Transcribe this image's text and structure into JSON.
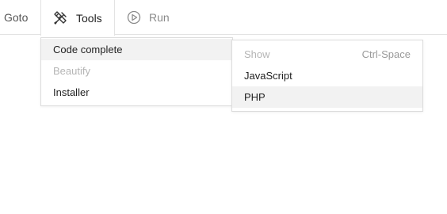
{
  "toolbar": {
    "goto_label": "Goto",
    "tools_label": "Tools",
    "run_label": "Run",
    "tools_icon": "tools-icon",
    "run_icon": "play-circle-icon"
  },
  "tools_menu": {
    "items": [
      {
        "label": "Code complete",
        "state": "active"
      },
      {
        "label": "Beautify",
        "state": "disabled"
      },
      {
        "label": "Installer",
        "state": "normal"
      }
    ]
  },
  "code_complete_submenu": {
    "items": [
      {
        "label": "Show",
        "shortcut": "Ctrl-Space",
        "state": "disabled"
      },
      {
        "label": "JavaScript",
        "state": "normal"
      },
      {
        "label": "PHP",
        "state": "hover"
      }
    ]
  },
  "colors": {
    "hover_bg": "#f2f2f2",
    "disabled_text": "#b5b5b5",
    "border": "#dcdcdc"
  }
}
